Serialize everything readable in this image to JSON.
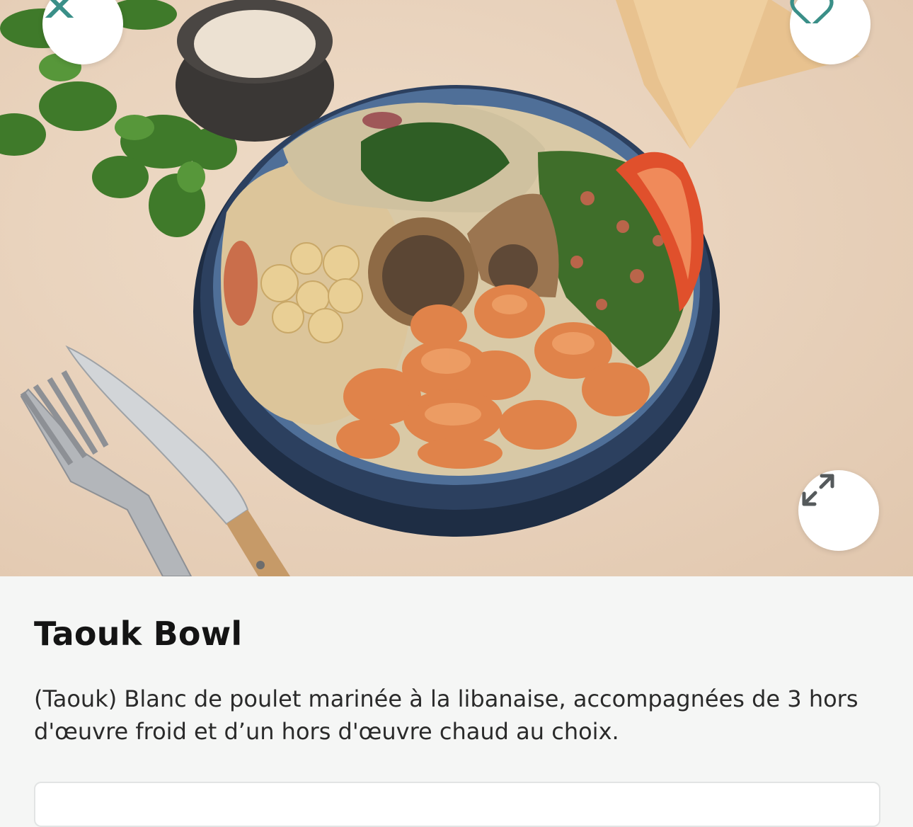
{
  "hero": {
    "close_icon": "close-icon",
    "favorite_icon": "heart-outline-icon",
    "expand_icon": "expand-arrows-icon",
    "accent_color": "#3a8f88"
  },
  "product": {
    "title": "Taouk Bowl",
    "description": "(Taouk) Blanc de poulet marinée à la libanaise, accompagnées de 3 hors d'œuvre froid et d’un hors d'œuvre chaud au choix."
  }
}
